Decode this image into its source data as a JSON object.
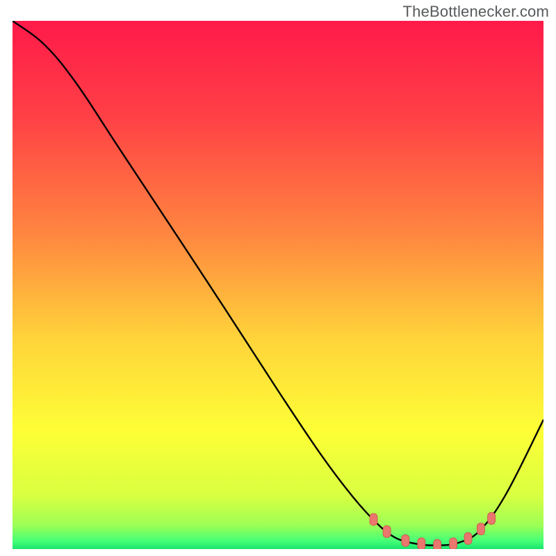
{
  "watermark": "TheBottlenecker.com",
  "chart_data": {
    "type": "line",
    "title": "",
    "xlabel": "",
    "ylabel": "",
    "xlim": [
      0,
      1
    ],
    "ylim": [
      0,
      1
    ],
    "gradient_stops": [
      {
        "offset": 0.0,
        "color": "#ff1a49"
      },
      {
        "offset": 0.18,
        "color": "#ff4046"
      },
      {
        "offset": 0.4,
        "color": "#ff8540"
      },
      {
        "offset": 0.6,
        "color": "#ffd33a"
      },
      {
        "offset": 0.78,
        "color": "#fdff36"
      },
      {
        "offset": 0.9,
        "color": "#d8ff41"
      },
      {
        "offset": 0.955,
        "color": "#9cff55"
      },
      {
        "offset": 0.985,
        "color": "#44ff77"
      },
      {
        "offset": 1.0,
        "color": "#19e46e"
      }
    ],
    "curve": [
      {
        "x": 0.0,
        "y": 1.0
      },
      {
        "x": 0.06,
        "y": 0.955
      },
      {
        "x": 0.12,
        "y": 0.882
      },
      {
        "x": 0.2,
        "y": 0.76
      },
      {
        "x": 0.3,
        "y": 0.608
      },
      {
        "x": 0.4,
        "y": 0.455
      },
      {
        "x": 0.5,
        "y": 0.3
      },
      {
        "x": 0.58,
        "y": 0.18
      },
      {
        "x": 0.64,
        "y": 0.1
      },
      {
        "x": 0.685,
        "y": 0.05
      },
      {
        "x": 0.72,
        "y": 0.022
      },
      {
        "x": 0.76,
        "y": 0.01
      },
      {
        "x": 0.8,
        "y": 0.007
      },
      {
        "x": 0.84,
        "y": 0.012
      },
      {
        "x": 0.88,
        "y": 0.035
      },
      {
        "x": 0.93,
        "y": 0.105
      },
      {
        "x": 1.0,
        "y": 0.245
      }
    ],
    "markers": [
      {
        "x": 0.68,
        "y": 0.056
      },
      {
        "x": 0.705,
        "y": 0.033
      },
      {
        "x": 0.74,
        "y": 0.016
      },
      {
        "x": 0.77,
        "y": 0.01
      },
      {
        "x": 0.8,
        "y": 0.007
      },
      {
        "x": 0.83,
        "y": 0.01
      },
      {
        "x": 0.858,
        "y": 0.02
      },
      {
        "x": 0.882,
        "y": 0.038
      },
      {
        "x": 0.902,
        "y": 0.058
      }
    ],
    "colors": {
      "curve": "#000000",
      "marker_fill": "#e9776e",
      "marker_stroke": "#d04f48",
      "border": "#ffffff"
    }
  }
}
